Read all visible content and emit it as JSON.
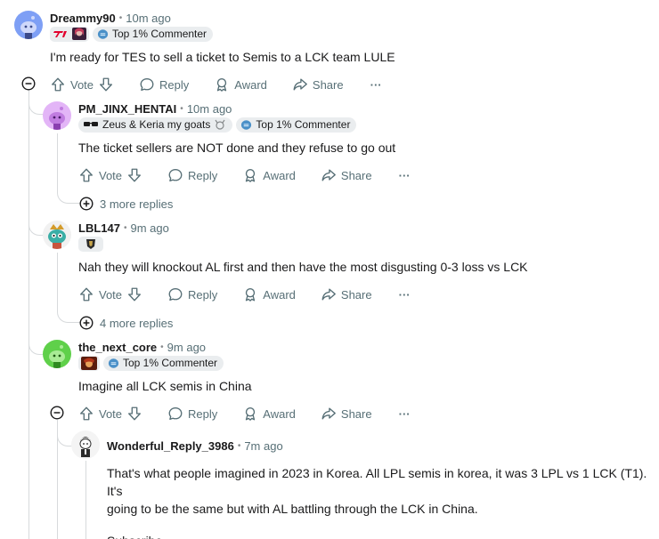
{
  "icons": {
    "collapse": "minus-circle-icon",
    "expand": "plus-circle-icon",
    "upvote": "arrow-up-icon",
    "downvote": "arrow-down-icon",
    "reply": "speech-bubble-icon",
    "award": "award-icon",
    "share": "share-arrow-icon",
    "overflow": "ellipsis-icon"
  },
  "labels": {
    "vote": "Vote",
    "reply": "Reply",
    "award": "Award",
    "share": "Share",
    "overflow": "···",
    "dot": "•"
  },
  "colors": {
    "thread_line": "#d7dadc",
    "meta": "#576f76",
    "flair_bg": "#eaedef"
  },
  "comments": [
    {
      "user": "Dreammy90",
      "time": "10m ago",
      "flair_images": [
        "t1-logo",
        "champion-portrait"
      ],
      "badge": "Top 1% Commenter",
      "text": "I'm ready for TES to sell a ticket to Semis to a LCK team LULE"
    },
    {
      "user": "PM_JINX_HENTAI",
      "time": "10m ago",
      "flair_text": "Zeus & Keria my goats",
      "badge": "Top 1% Commenter",
      "text": "The ticket sellers are NOT done and they refuse to go out",
      "more_replies": "3 more replies"
    },
    {
      "user": "LBL147",
      "time": "9m ago",
      "flair_images": [
        "team-logo"
      ],
      "text": "Nah they will knockout AL first and then have the most disgusting 0-3 loss vs LCK",
      "more_replies": "4 more replies"
    },
    {
      "user": "the_next_core",
      "time": "9m ago",
      "flair_images": [
        "champion-portrait"
      ],
      "badge": "Top 1% Commenter",
      "text": "Imagine all LCK semis in China"
    },
    {
      "user": "Wonderful_Reply_3986",
      "time": "7m ago",
      "text_lines": [
        "That's what people imagined in 2023 in Korea. All LPL semis in korea, it was 3 LPL vs 1 LCK (T1). It's",
        "going to be the same but with AL battling through the LCK in China."
      ],
      "text_2": "Subscribe."
    }
  ]
}
